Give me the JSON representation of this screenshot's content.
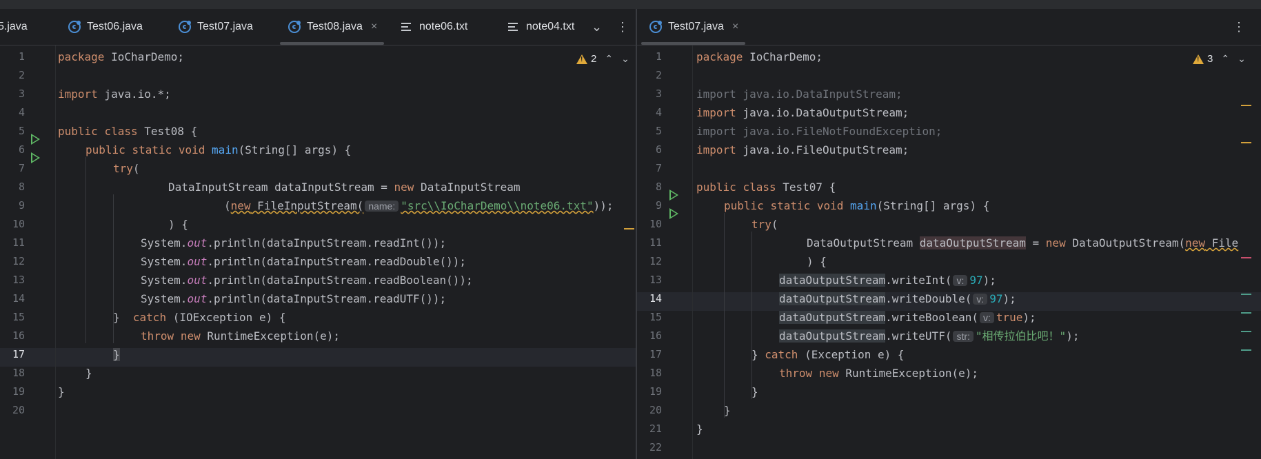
{
  "colors": {
    "background": "#1e1f22",
    "keyword": "#cf8e6d",
    "method": "#56a8f5",
    "string": "#6aab73",
    "number": "#2aacb8",
    "static_field": "#c77dbb",
    "run_icon": "#5fb865",
    "warning": "#e0a93a"
  },
  "left_pane": {
    "tabs": [
      {
        "label": "5.java",
        "icon": "java-class-icon"
      },
      {
        "label": "Test06.java",
        "icon": "java-class-icon"
      },
      {
        "label": "Test07.java",
        "icon": "java-class-icon"
      },
      {
        "label": "Test08.java",
        "icon": "java-class-icon",
        "active": true,
        "close": "×"
      },
      {
        "label": "note06.txt",
        "icon": "text-file-icon"
      },
      {
        "label": "note04.txt",
        "icon": "text-file-icon"
      }
    ],
    "tab_overflow": "⌄",
    "more": "⋮",
    "inspection": {
      "count": "2",
      "up": "⌃",
      "down": "⌄"
    },
    "current_line": "17",
    "line_numbers": [
      "1",
      "2",
      "3",
      "4",
      "5",
      "6",
      "7",
      "8",
      "9",
      "10",
      "11",
      "12",
      "13",
      "14",
      "15",
      "16",
      "17",
      "18",
      "19",
      "20"
    ],
    "code": {
      "l1a": "package",
      "l1b": " IoCharDemo;",
      "l3a": "import",
      "l3b": " java.io.*;",
      "l5a": "public",
      "l5b": " ",
      "l5c": "class",
      "l5d": " Test08 {",
      "l6a": "public",
      "l6b": "static",
      "l6c": "void",
      "l6d": "main",
      "l6e": "(String[] args) {",
      "l7a": "try",
      "l7b": "(",
      "l8a": "DataInputStream dataInputStream = ",
      "l8b": "new",
      "l8c": " DataInputStream",
      "l9a": "(",
      "l9b": "new",
      "l9c": " FileInputStream(",
      "l9hint": "name:",
      "l9d": "\"src\\\\IoCharDemo\\\\note06.txt\"",
      "l9e": "));",
      "l10": ") {",
      "l11a": "System.",
      "l11b": "out",
      "l11c": ".println(dataInputStream.readInt());",
      "l12a": "System.",
      "l12b": "out",
      "l12c": ".println(dataInputStream.readDouble());",
      "l13a": "System.",
      "l13b": "out",
      "l13c": ".println(dataInputStream.readBoolean());",
      "l14a": "System.",
      "l14b": "out",
      "l14c": ".println(dataInputStream.readUTF());",
      "l15a": "}  ",
      "l15b": "catch",
      "l15c": " (IOException e) {",
      "l16a": "throw",
      "l16b": "new",
      "l16c": " RuntimeException(e);",
      "l17": "}",
      "l18": "}",
      "l19": "}"
    }
  },
  "right_pane": {
    "tabs": [
      {
        "label": "Test07.java",
        "icon": "java-class-icon",
        "active": true,
        "close": "×"
      }
    ],
    "more": "⋮",
    "inspection": {
      "count": "3",
      "up": "⌃",
      "down": "⌄"
    },
    "current_line": "14",
    "line_numbers": [
      "1",
      "2",
      "3",
      "4",
      "5",
      "6",
      "7",
      "8",
      "9",
      "10",
      "11",
      "12",
      "13",
      "14",
      "15",
      "16",
      "17",
      "18",
      "19",
      "20",
      "21",
      "22"
    ],
    "code": {
      "l1a": "package",
      "l1b": " IoCharDemo;",
      "l3": "import java.io.DataInputStream;",
      "l4a": "import",
      "l4b": " java.io.DataOutputStream;",
      "l5": "import java.io.FileNotFoundException;",
      "l6a": "import",
      "l6b": " java.io.FileOutputStream;",
      "l8a": "public",
      "l8b": "class",
      "l8c": " Test07 {",
      "l9a": "public",
      "l9b": "static",
      "l9c": "void",
      "l9d": "main",
      "l9e": "(String[] args) {",
      "l10a": "try",
      "l10b": "(",
      "l11a": "DataOutputStream ",
      "l11b": "dataOutputStream",
      "l11c": " = ",
      "l11d": "new",
      "l11e": " DataOutputStream(",
      "l11f": "new",
      "l11g": " File",
      "l12": ") {",
      "var": "dataOutputStream",
      "l13a": ".writeInt(",
      "l13hint": "v:",
      "l13b": "97",
      "l13c": ");",
      "l14a": ".writeDouble(",
      "l14hint": "v:",
      "l14b": "97",
      "l14c": ");",
      "l15a": ".writeBoolean(",
      "l15hint": "v:",
      "l15b": "true",
      "l15c": ");",
      "l16a": ".writeUTF(",
      "l16hint": "str:",
      "l16b": "\"相传拉伯比吧！\"",
      "l16c": ");",
      "l17a": "} ",
      "l17b": "catch",
      "l17c": " (Exception e) {",
      "l18a": "throw",
      "l18b": "new",
      "l18c": " RuntimeException(e);",
      "l19": "}",
      "l20": "}",
      "l21": "}"
    }
  }
}
